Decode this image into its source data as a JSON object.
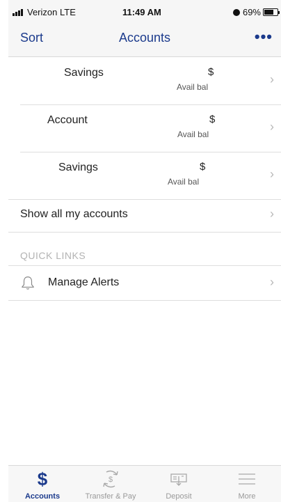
{
  "status_bar": {
    "carrier": "Verizon",
    "network": "LTE",
    "time": "11:49 AM",
    "battery": "69%"
  },
  "nav": {
    "sort_label": "Sort",
    "title": "Accounts",
    "more_label": "•••"
  },
  "accounts": [
    {
      "name": "Savings",
      "balance": "$",
      "balance_label": "Avail bal"
    },
    {
      "name": "Account",
      "balance": "$",
      "balance_label": "Avail bal"
    },
    {
      "name": "Savings",
      "balance": "$",
      "balance_label": "Avail bal"
    }
  ],
  "show_all_label": "Show all my accounts",
  "quick_links": {
    "header": "QUICK LINKS",
    "items": [
      {
        "label": "Manage Alerts",
        "icon": "bell-icon"
      }
    ]
  },
  "chevron": "›",
  "tab_bar": {
    "active": "Accounts",
    "tabs": [
      {
        "label": "Accounts",
        "icon": "dollar-icon"
      },
      {
        "label": "Transfer & Pay",
        "icon": "transfer-pay-icon"
      },
      {
        "label": "Deposit",
        "icon": "deposit-icon"
      },
      {
        "label": "More",
        "icon": "menu-icon"
      }
    ],
    "dollar_symbol": "$"
  },
  "colors": {
    "accent": "#1b3a8c",
    "divider": "#dedede",
    "muted": "#b3b3b3"
  }
}
